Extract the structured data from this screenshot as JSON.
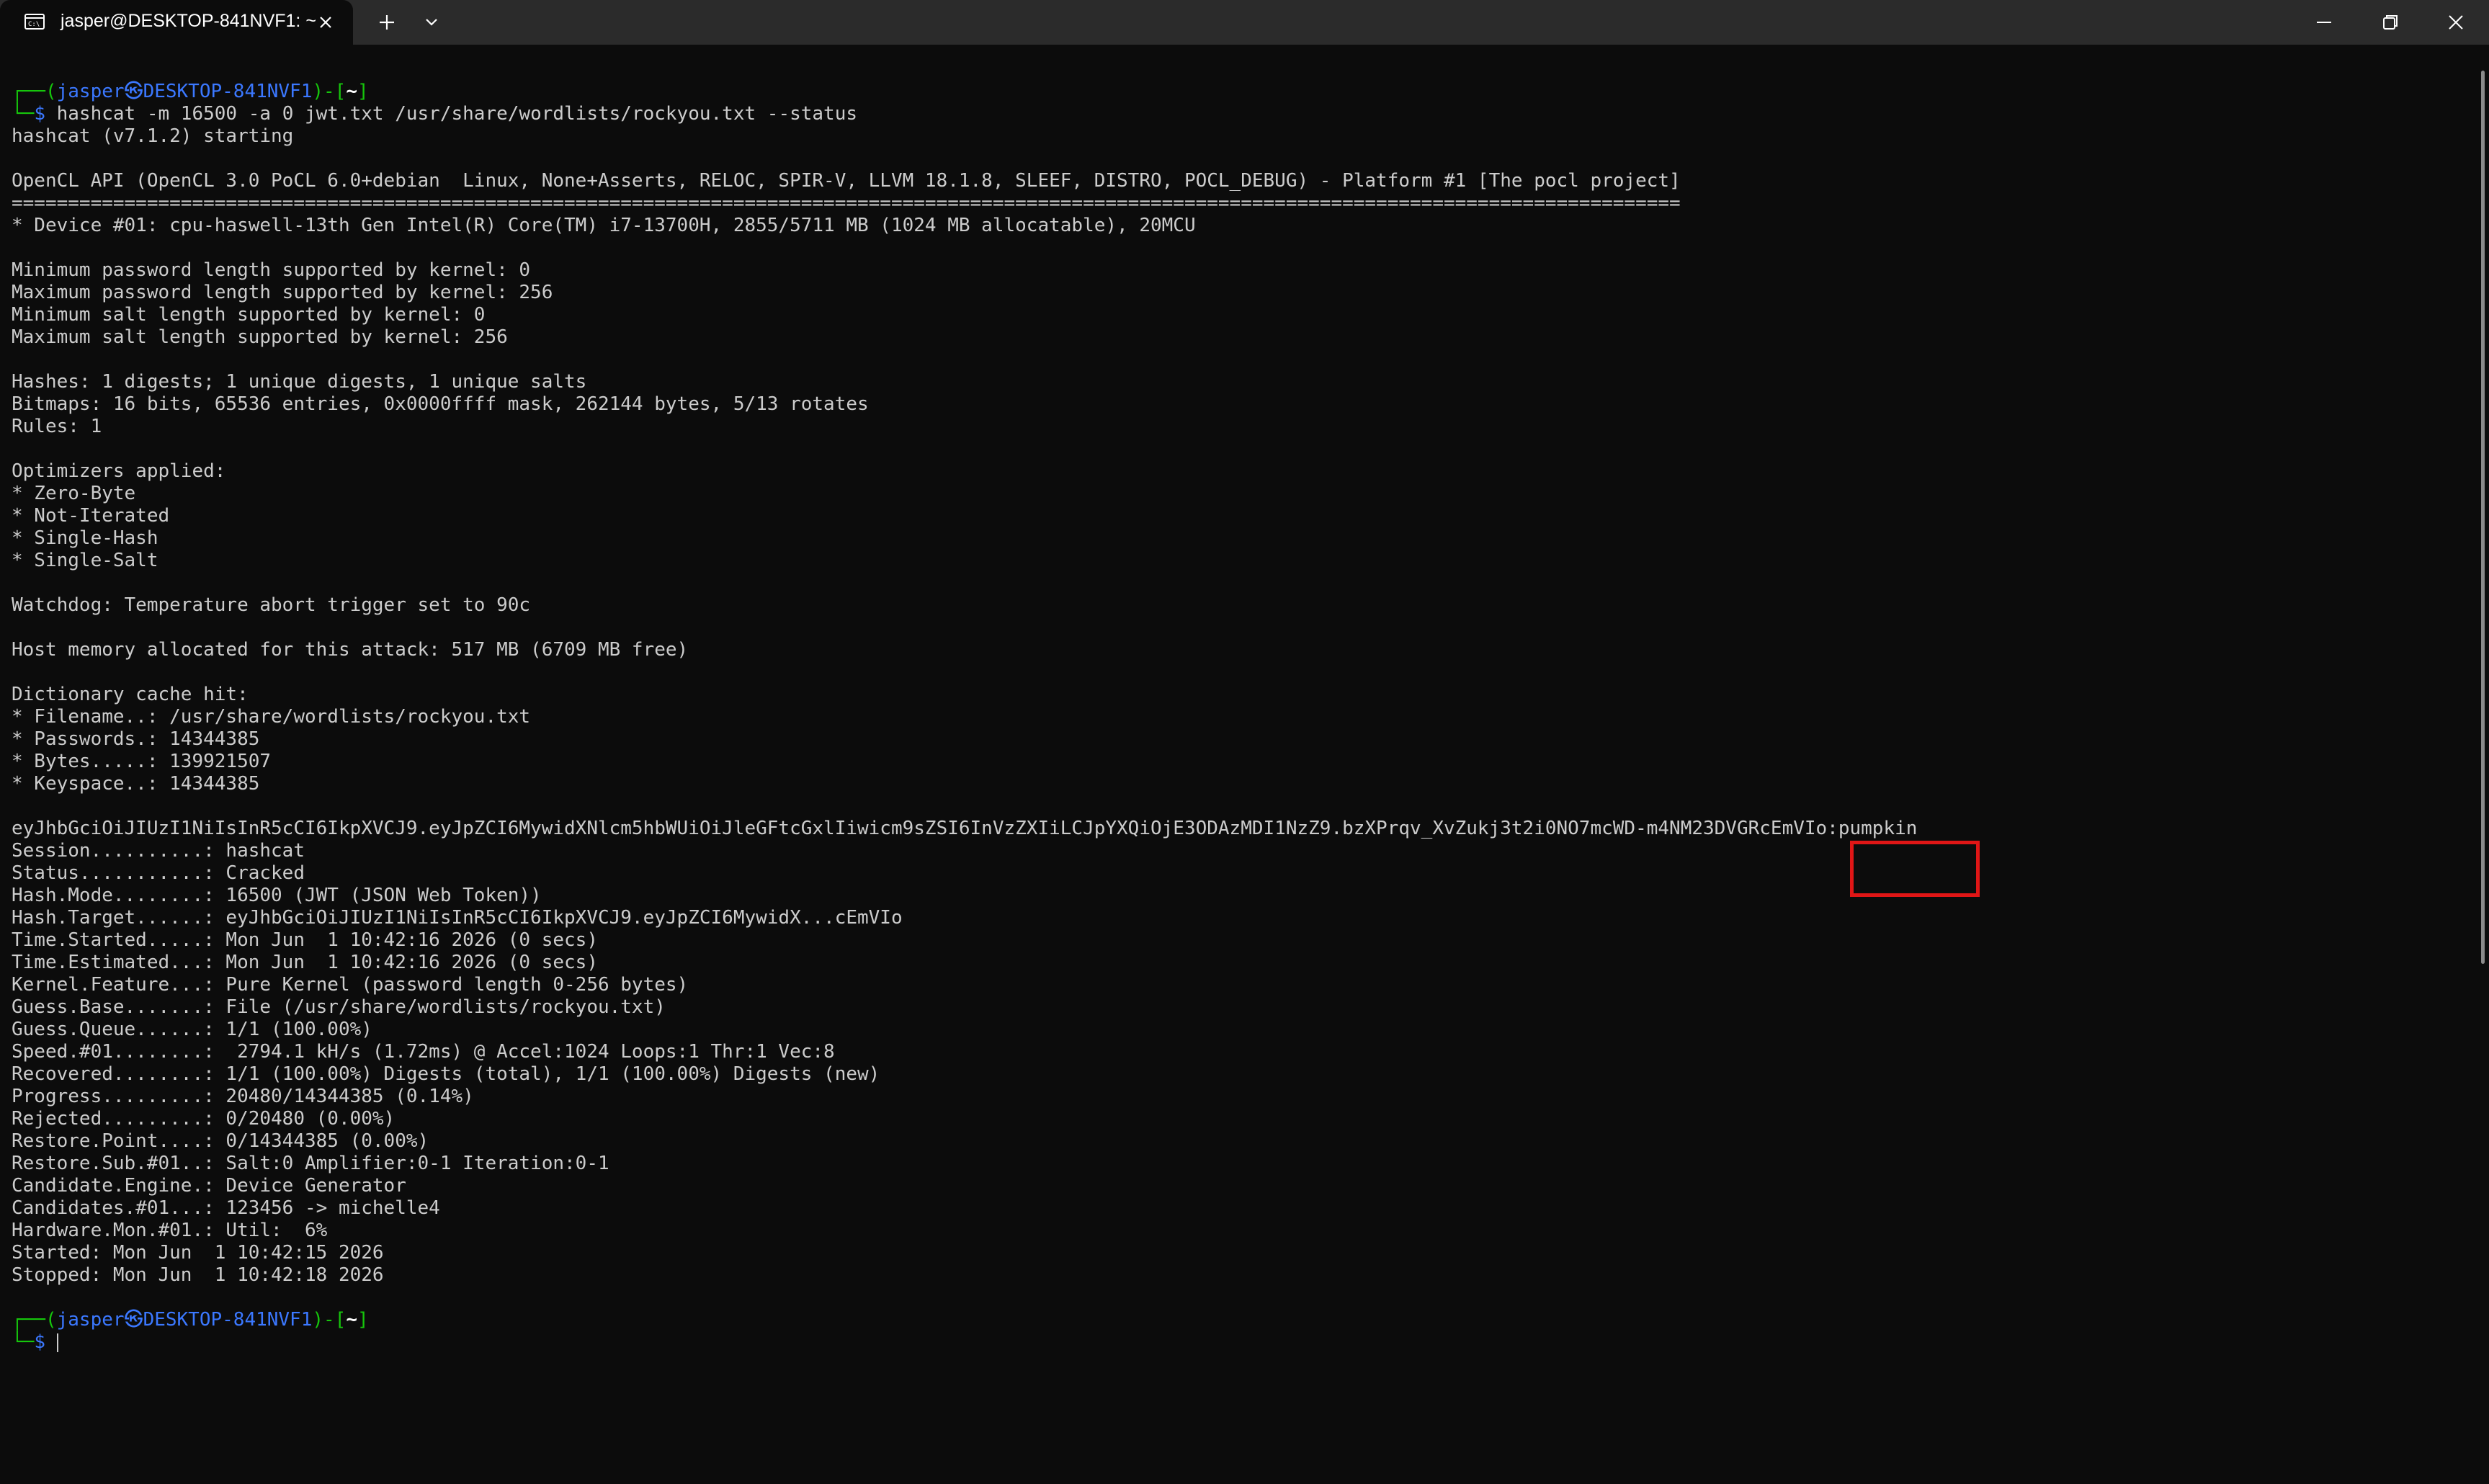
{
  "titlebar": {
    "tab_title": "jasper@DESKTOP-841NVF1: ~",
    "icons": {
      "tab": "terminal-icon",
      "close_tab": "close-icon",
      "new_tab": "plus-icon",
      "dropdown": "chevron-down-icon",
      "minimize": "minimize-icon",
      "maximize": "restore-icon",
      "close_window": "close-icon"
    }
  },
  "colors": {
    "background": "#0c0c0c",
    "prompt_green": "#16c60c",
    "prompt_blue": "#3b78ff",
    "text": "#cccccc",
    "highlight_red": "#e01616"
  },
  "terminal": {
    "prompt1": {
      "corner": "┌──(",
      "user": "jasper",
      "sep": "㉿",
      "host": "DESKTOP-841NVF1",
      "mid": ")-[",
      "dir": "~",
      "end": "]",
      "line2": "└─",
      "dollar": "$ ",
      "command": "hashcat -m 16500 -a 0 jwt.txt /usr/share/wordlists/rockyou.txt --status"
    },
    "output": [
      "hashcat (v7.1.2) starting",
      "",
      "OpenCL API (OpenCL 3.0 PoCL 6.0+debian  Linux, None+Asserts, RELOC, SPIR-V, LLVM 18.1.8, SLEEF, DISTRO, POCL_DEBUG) - Platform #1 [The pocl project]",
      "====================================================================================================================================================",
      "* Device #01: cpu-haswell-13th Gen Intel(R) Core(TM) i7-13700H, 2855/5711 MB (1024 MB allocatable), 20MCU",
      "",
      "Minimum password length supported by kernel: 0",
      "Maximum password length supported by kernel: 256",
      "Minimum salt length supported by kernel: 0",
      "Maximum salt length supported by kernel: 256",
      "",
      "Hashes: 1 digests; 1 unique digests, 1 unique salts",
      "Bitmaps: 16 bits, 65536 entries, 0x0000ffff mask, 262144 bytes, 5/13 rotates",
      "Rules: 1",
      "",
      "Optimizers applied:",
      "* Zero-Byte",
      "* Not-Iterated",
      "* Single-Hash",
      "* Single-Salt",
      "",
      "Watchdog: Temperature abort trigger set to 90c",
      "",
      "Host memory allocated for this attack: 517 MB (6709 MB free)",
      "",
      "Dictionary cache hit:",
      "* Filename..: /usr/share/wordlists/rockyou.txt",
      "* Passwords.: 14344385",
      "* Bytes.....: 139921507",
      "* Keyspace..: 14344385",
      "",
      "eyJhbGciOiJIUzI1NiIsInR5cCI6IkpXVCJ9.eyJpZCI6MywidXNlcm5hbWUiOiJleGFtcGxlIiwicm9sZSI6InVzZXIiLCJpYXQiOjE3ODAzMDI1NzZ9.bzXPrqv_XvZukj3t2i0NO7mcWD-m4NM23DVGRcEmVIo:pumpkin",
      "Session..........: hashcat",
      "Status...........: Cracked",
      "Hash.Mode........: 16500 (JWT (JSON Web Token))",
      "Hash.Target......: eyJhbGciOiJIUzI1NiIsInR5cCI6IkpXVCJ9.eyJpZCI6MywidX...cEmVIo",
      "Time.Started.....: Mon Jun  1 10:42:16 2026 (0 secs)",
      "Time.Estimated...: Mon Jun  1 10:42:16 2026 (0 secs)",
      "Kernel.Feature...: Pure Kernel (password length 0-256 bytes)",
      "Guess.Base.......: File (/usr/share/wordlists/rockyou.txt)",
      "Guess.Queue......: 1/1 (100.00%)",
      "Speed.#01........:  2794.1 kH/s (1.72ms) @ Accel:1024 Loops:1 Thr:1 Vec:8",
      "Recovered........: 1/1 (100.00%) Digests (total), 1/1 (100.00%) Digests (new)",
      "Progress.........: 20480/14344385 (0.14%)",
      "Rejected.........: 0/20480 (0.00%)",
      "Restore.Point....: 0/14344385 (0.00%)",
      "Restore.Sub.#01..: Salt:0 Amplifier:0-1 Iteration:0-1",
      "Candidate.Engine.: Device Generator",
      "Candidates.#01...: 123456 -> michelle4",
      "Hardware.Mon.#01.: Util:  6%",
      "Started: Mon Jun  1 10:42:15 2026",
      "Stopped: Mon Jun  1 10:42:18 2026",
      ""
    ],
    "prompt2": {
      "corner": "┌──(",
      "user": "jasper",
      "sep": "㉿",
      "host": "DESKTOP-841NVF1",
      "mid": ")-[",
      "dir": "~",
      "end": "]",
      "line2": "└─",
      "dollar": "$ ",
      "command": ""
    }
  }
}
